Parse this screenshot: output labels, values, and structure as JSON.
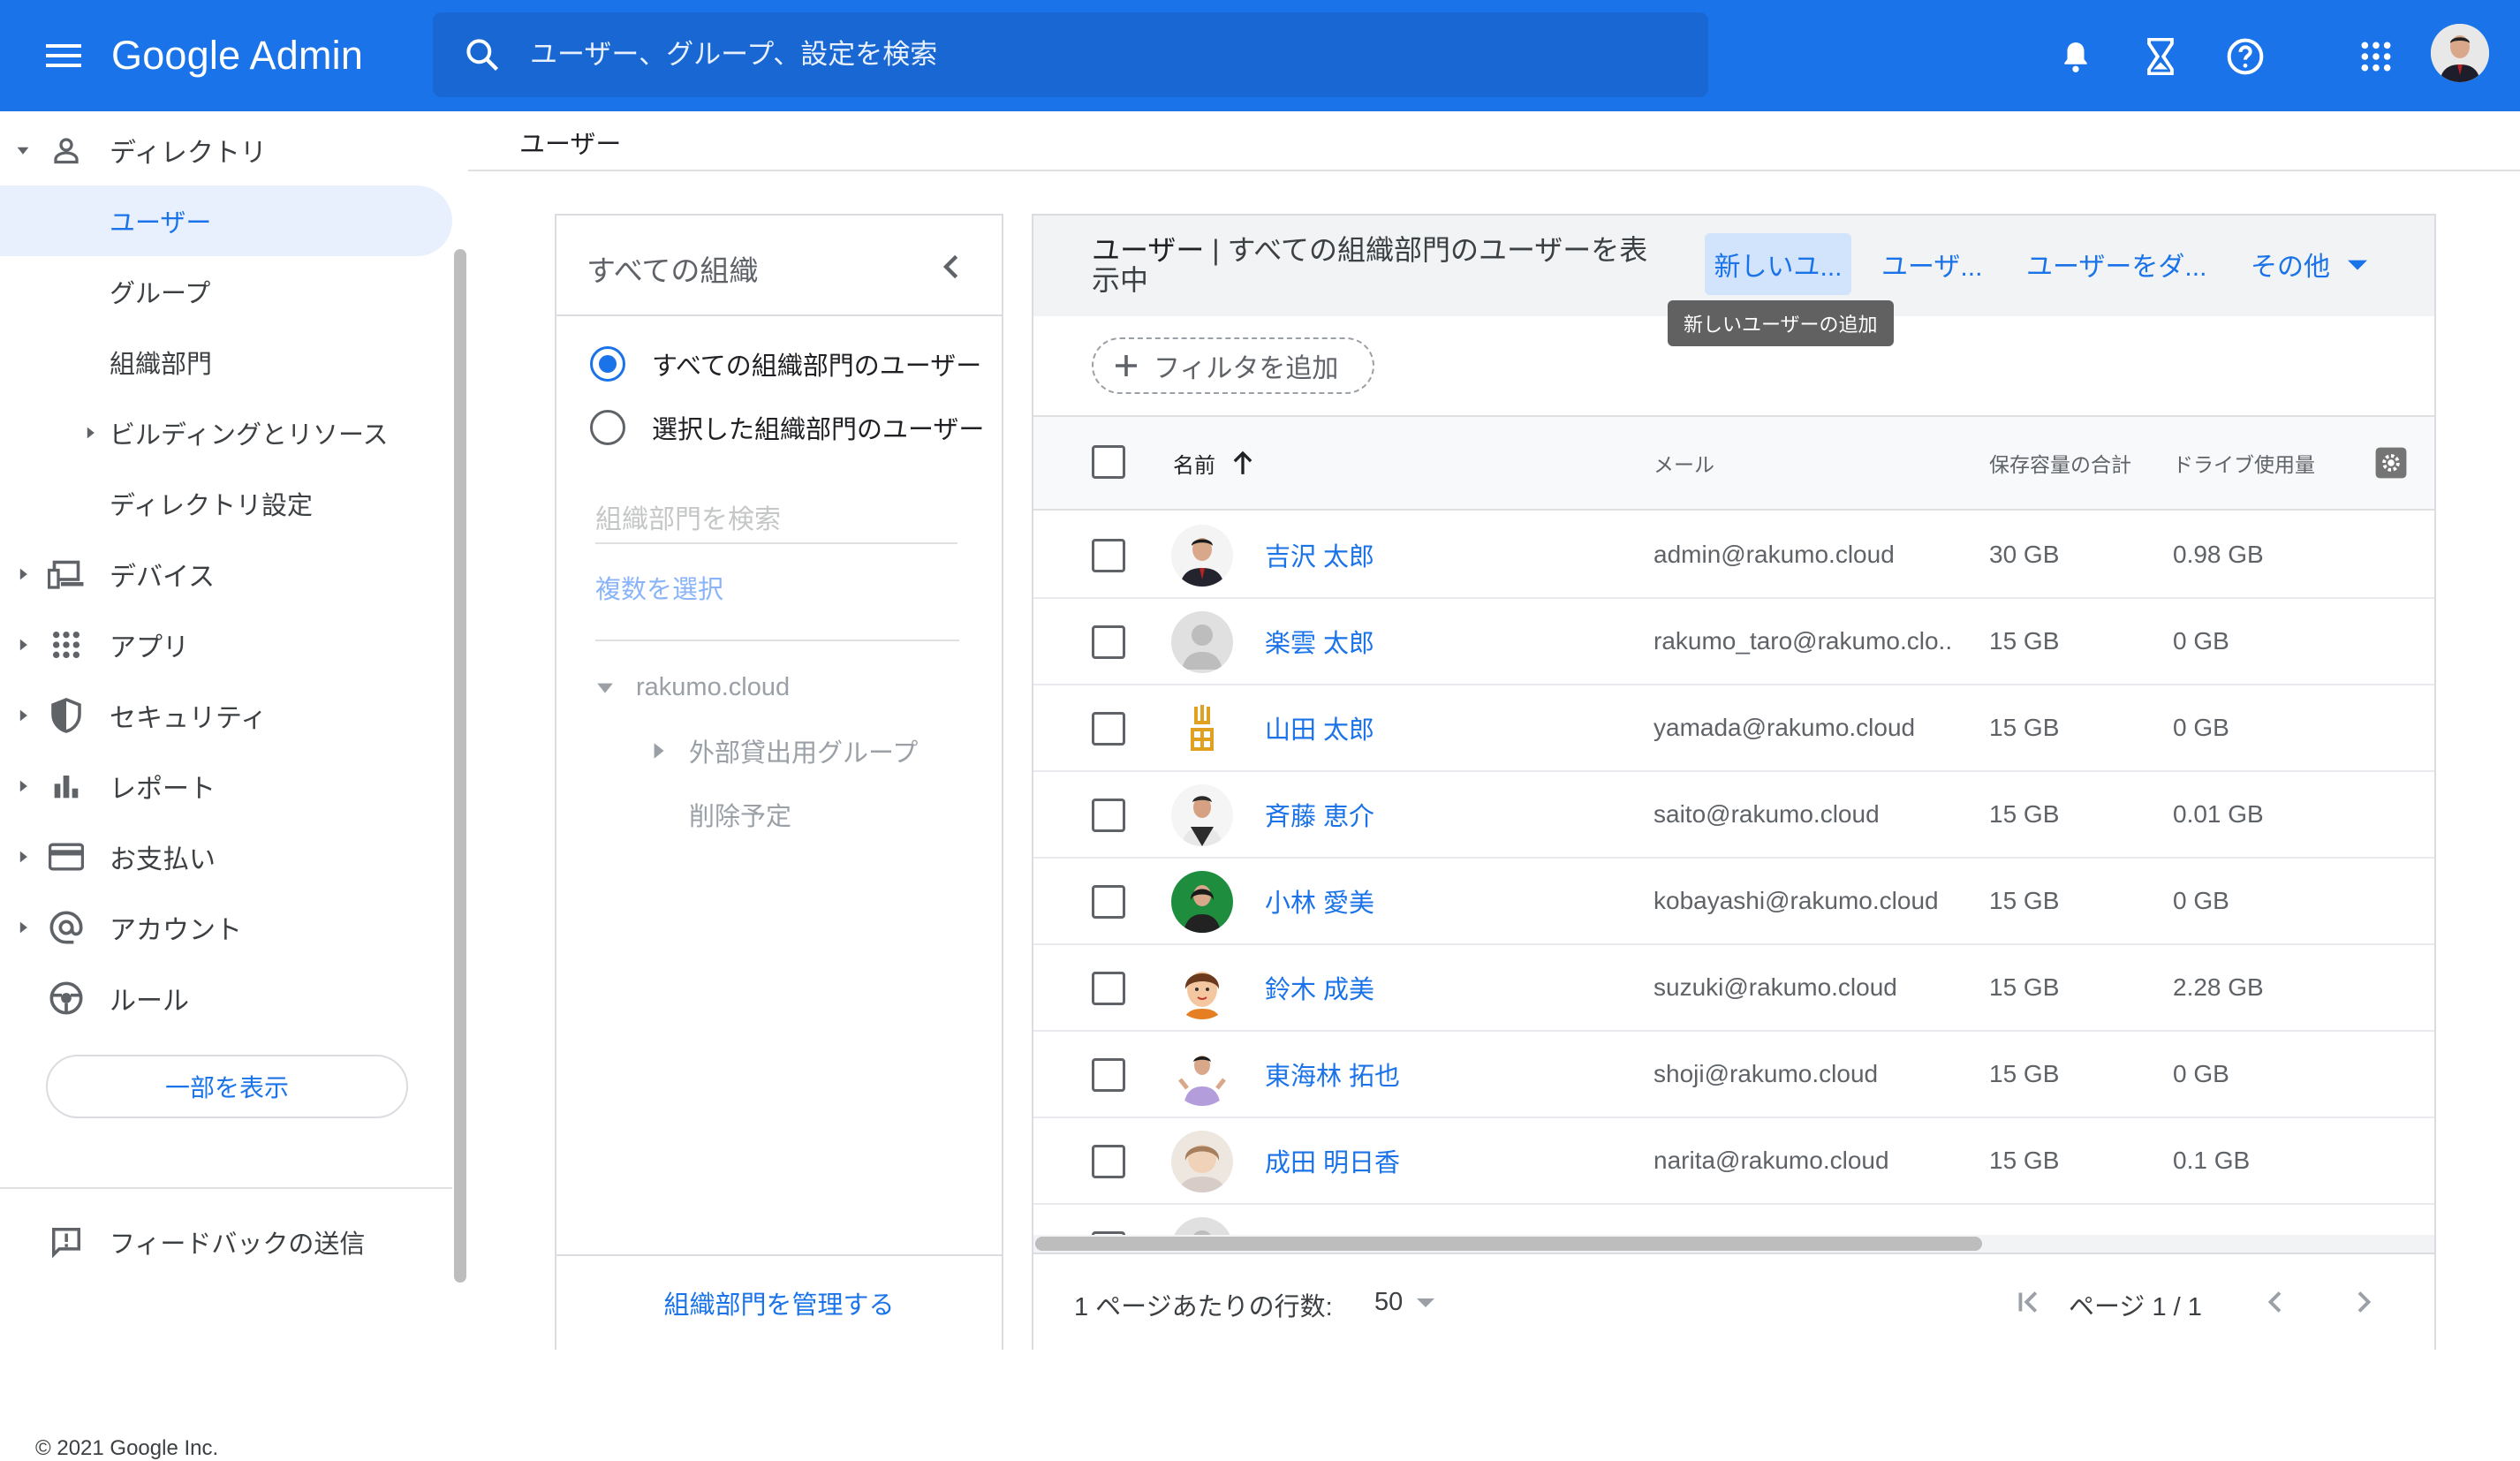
{
  "app": {
    "brand": "Google Admin"
  },
  "search": {
    "placeholder": "ユーザー、グループ、設定を検索"
  },
  "topbar_icons": [
    "menu-icon",
    "bell-icon",
    "hourglass-icon",
    "help-icon",
    "apps-grid-icon",
    "account-avatar"
  ],
  "sidebar": {
    "directory": "ディレクトリ",
    "users": "ユーザー",
    "groups": "グループ",
    "org_units": "組織部門",
    "buildings": "ビルディングとリソース",
    "directory_settings": "ディレクトリ設定",
    "devices": "デバイス",
    "apps": "アプリ",
    "security": "セキュリティ",
    "reports": "レポート",
    "billing": "お支払い",
    "account": "アカウント",
    "rules": "ルール",
    "show_less": "一部を表示",
    "feedback": "フィードバックの送信",
    "copyright": "© 2021 Google Inc."
  },
  "breadcrumb": "ユーザー",
  "org_panel": {
    "title": "すべての組織",
    "radio_all": "すべての組織部門のユーザー",
    "radio_selected": "選択した組織部門のユーザー",
    "search_placeholder": "組織部門を検索",
    "multi_select": "複数を選択",
    "tree_root": "rakumo.cloud",
    "tree_child1": "外部貸出用グループ",
    "tree_child2": "削除予定",
    "manage": "組織部門を管理する"
  },
  "user_panel": {
    "title_bold": "ユーザー",
    "title_rest": " | すべての組織部門のユーザーを表示中",
    "action_new": "新しいユ...",
    "action_upload": "ユーザ...",
    "action_download": "ユーザーをダ...",
    "action_more": "その他",
    "tooltip": "新しいユーザーの追加",
    "add_filter": "フィルタを追加",
    "columns": {
      "name": "名前",
      "email": "メール",
      "storage": "保存容量の合計",
      "drive": "ドライブ使用量"
    }
  },
  "users": [
    {
      "name": "吉沢 太郎",
      "email": "admin@rakumo.cloud",
      "storage": "30 GB",
      "drive": "0.98 GB"
    },
    {
      "name": "楽雲 太郎",
      "email": "rakumo_taro@rakumo.clo...",
      "storage": "15 GB",
      "drive": "0 GB"
    },
    {
      "name": "山田 太郎",
      "email": "yamada@rakumo.cloud",
      "storage": "15 GB",
      "drive": "0 GB"
    },
    {
      "name": "斉藤 恵介",
      "email": "saito@rakumo.cloud",
      "storage": "15 GB",
      "drive": "0.01 GB"
    },
    {
      "name": "小林 愛美",
      "email": "kobayashi@rakumo.cloud",
      "storage": "15 GB",
      "drive": "0 GB"
    },
    {
      "name": "鈴木 成美",
      "email": "suzuki@rakumo.cloud",
      "storage": "15 GB",
      "drive": "2.28 GB"
    },
    {
      "name": "東海林 拓也",
      "email": "shoji@rakumo.cloud",
      "storage": "15 GB",
      "drive": "0 GB"
    },
    {
      "name": "成田 明日香",
      "email": "narita@rakumo.cloud",
      "storage": "15 GB",
      "drive": "0.1 GB"
    }
  ],
  "pagination": {
    "rows_label": "1 ページあたりの行数:",
    "rows_value": "50",
    "page_label": "ページ 1 / 1"
  },
  "colors": {
    "brand": "#1a73e8",
    "search_bg": "#1967d2",
    "selected_nav": "#e8f0fe"
  }
}
